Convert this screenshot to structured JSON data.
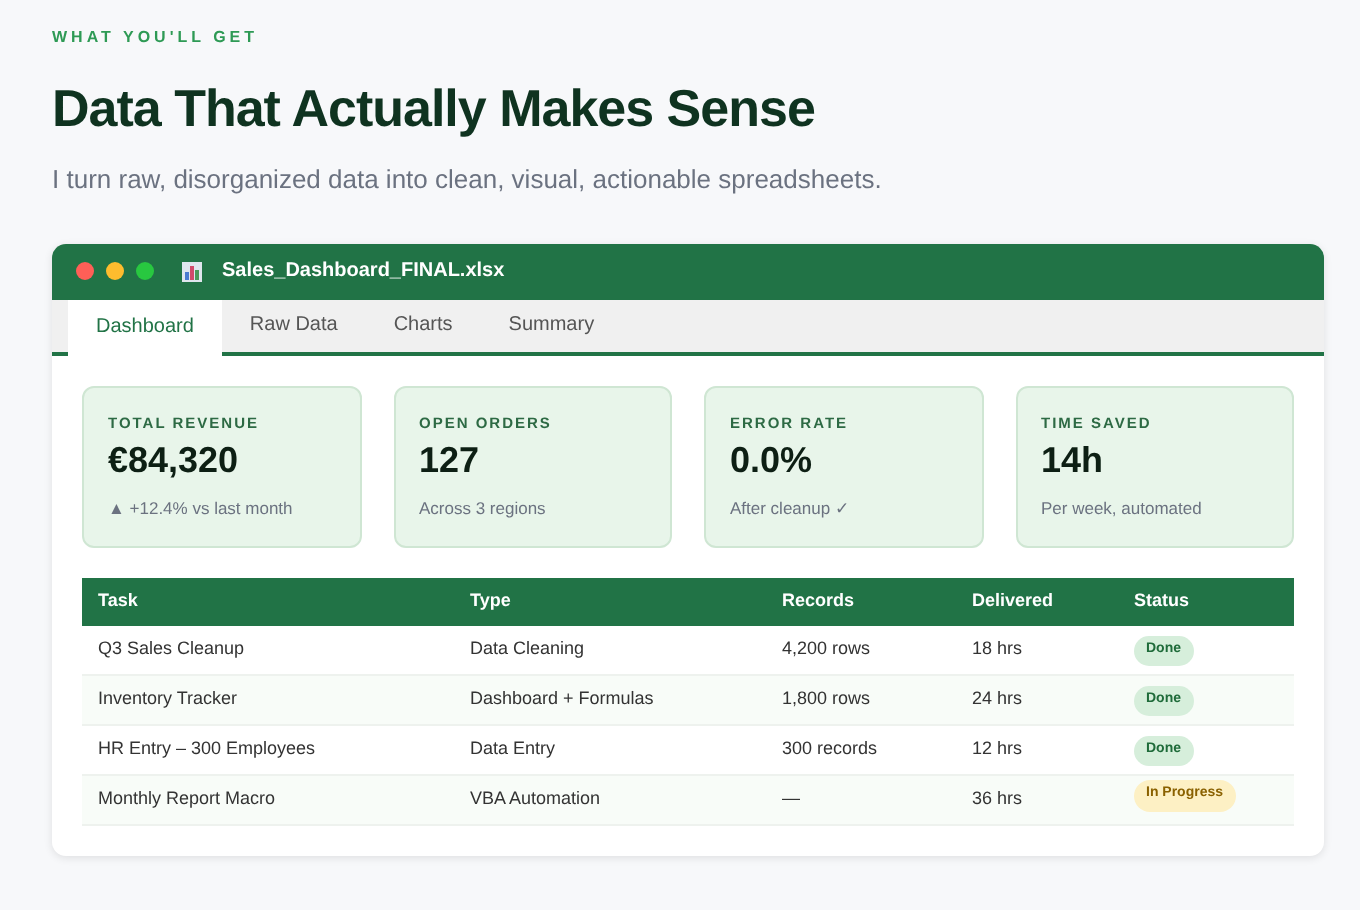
{
  "eyebrow": "WHAT YOU'LL GET",
  "heading": "Data That Actually Makes Sense",
  "subheading": "I turn raw, disorganized data into clean, visual, actionable spreadsheets.",
  "window": {
    "title": "Sales_Dashboard_FINAL.xlsx"
  },
  "tabs": [
    {
      "label": "Dashboard",
      "selected": true
    },
    {
      "label": "Raw Data",
      "selected": false
    },
    {
      "label": "Charts",
      "selected": false
    },
    {
      "label": "Summary",
      "selected": false
    }
  ],
  "stats": [
    {
      "label": "TOTAL REVENUE",
      "value": "€84,320",
      "note": "▲ +12.4% vs last month"
    },
    {
      "label": "OPEN ORDERS",
      "value": "127",
      "note": "Across 3 regions"
    },
    {
      "label": "ERROR RATE",
      "value": "0.0%",
      "note": "After cleanup ✓"
    },
    {
      "label": "TIME SAVED",
      "value": "14h",
      "note": "Per week, automated"
    }
  ],
  "table": {
    "columns": [
      "Task",
      "Type",
      "Records",
      "Delivered",
      "Status"
    ],
    "rows": [
      {
        "cells": [
          "Q3 Sales Cleanup",
          "Data Cleaning",
          "4,200 rows",
          "18 hrs"
        ],
        "status": {
          "text": "Done",
          "kind": "done"
        }
      },
      {
        "cells": [
          "Inventory Tracker",
          "Dashboard + Formulas",
          "1,800 rows",
          "24 hrs"
        ],
        "status": {
          "text": "Done",
          "kind": "done"
        }
      },
      {
        "cells": [
          "HR Entry – 300 Employees",
          "Data Entry",
          "300 records",
          "12 hrs"
        ],
        "status": {
          "text": "Done",
          "kind": "done"
        }
      },
      {
        "cells": [
          "Monthly Report Macro",
          "VBA Automation",
          "—",
          "36 hrs"
        ],
        "status": {
          "text": "In Progress",
          "kind": "progress"
        }
      }
    ]
  }
}
